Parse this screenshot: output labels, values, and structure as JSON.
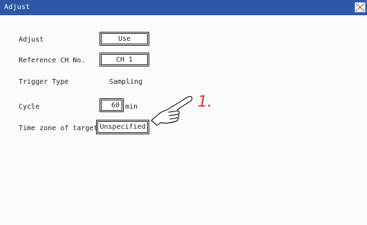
{
  "window": {
    "title": "Adjust",
    "close_icon": "close-x-icon",
    "colors": {
      "titlebar": "#2d57a7",
      "accent": "#e0302a"
    }
  },
  "form": {
    "adjust": {
      "label": "Adjust",
      "value": "Use"
    },
    "reference_ch": {
      "label": "Reference CH No.",
      "value": "CH 1"
    },
    "trigger_type": {
      "label": "Trigger Type",
      "value": "Sampling"
    },
    "cycle": {
      "label": "Cycle",
      "value": "60",
      "unit": "min"
    },
    "time_zone": {
      "label": "Time zone of target",
      "value": "Unspecified"
    }
  },
  "annotation": {
    "step": "1.",
    "pointer_icon": "pointing-hand-icon"
  }
}
